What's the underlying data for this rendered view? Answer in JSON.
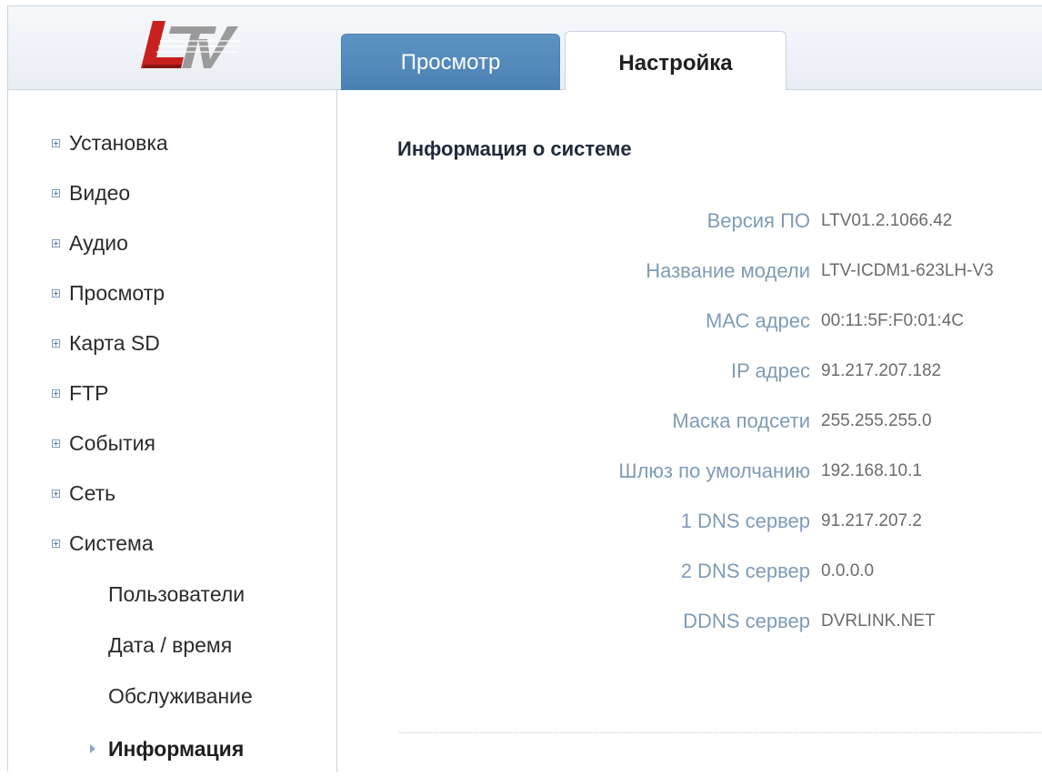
{
  "logo": {
    "text": "LTV"
  },
  "tabs": [
    {
      "label": "Просмотр",
      "active": false
    },
    {
      "label": "Настройка",
      "active": true
    }
  ],
  "sidebar": {
    "items": [
      {
        "label": "Установка"
      },
      {
        "label": "Видео"
      },
      {
        "label": "Аудио"
      },
      {
        "label": "Просмотр"
      },
      {
        "label": "Карта SD"
      },
      {
        "label": "FTP"
      },
      {
        "label": "События"
      },
      {
        "label": "Сеть"
      },
      {
        "label": "Система"
      }
    ],
    "subitems": [
      {
        "label": "Пользователи"
      },
      {
        "label": "Дата / время"
      },
      {
        "label": "Обслуживание"
      },
      {
        "label": "Информация",
        "active": true
      }
    ]
  },
  "main": {
    "title": "Информация о системе",
    "rows": [
      {
        "label": "Версия ПО",
        "value": "LTV01.2.1066.42"
      },
      {
        "label": "Название модели",
        "value": "LTV-ICDM1-623LH-V3"
      },
      {
        "label": "МАС адрес",
        "value": "00:11:5F:F0:01:4C"
      },
      {
        "label": "IP адрес",
        "value": "91.217.207.182"
      },
      {
        "label": "Маска подсети",
        "value": "255.255.255.0"
      },
      {
        "label": "Шлюз по умолчанию",
        "value": "192.168.10.1"
      },
      {
        "label": "1 DNS сервер",
        "value": "91.217.207.2"
      },
      {
        "label": "2 DNS сервер",
        "value": "0.0.0.0"
      },
      {
        "label": "DDNS сервер",
        "value": "DVRLINK.NET"
      }
    ]
  },
  "colors": {
    "tab_active_bg": "#ffffff",
    "tab_inactive_bg": "#4a80b4",
    "label_color": "#7f9bb6",
    "logo_red": "#c8201f",
    "logo_gray": "#9a9a9a"
  }
}
